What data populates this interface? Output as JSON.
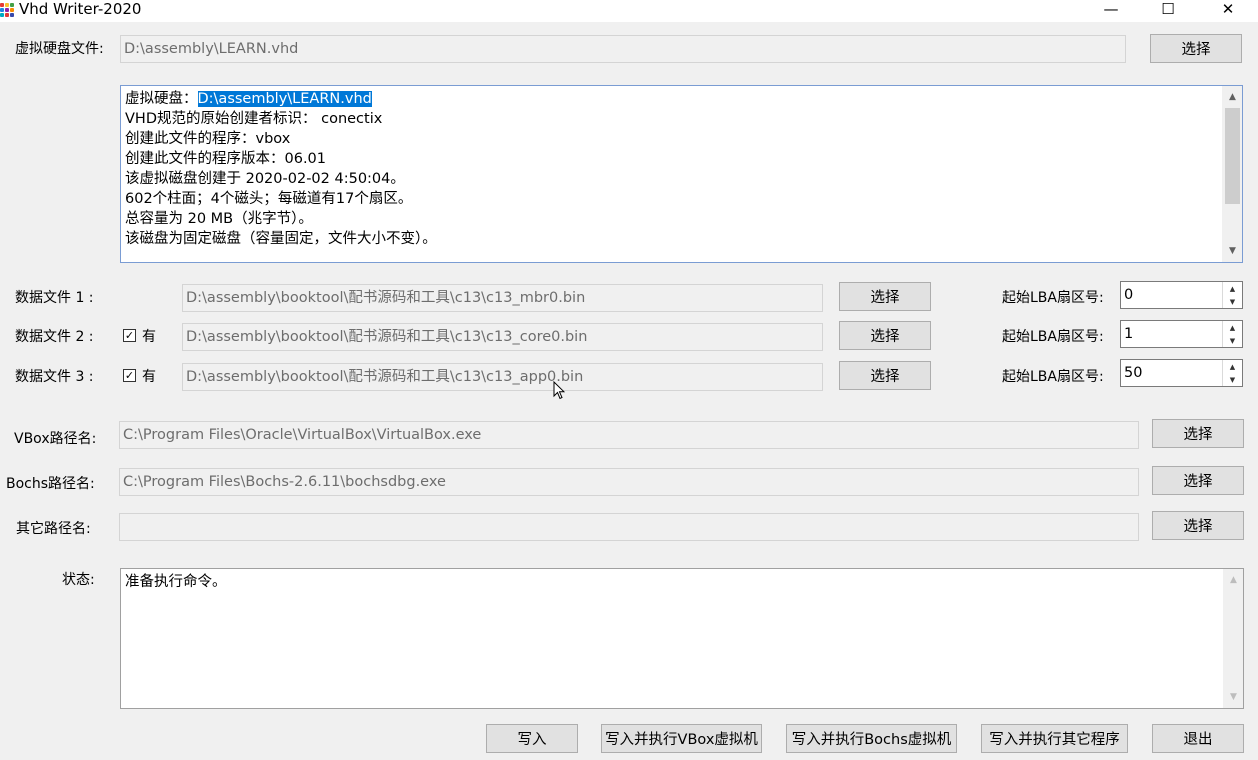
{
  "window": {
    "title": "Vhd Writer-2020",
    "minimize": "—",
    "maximize": "☐",
    "close": "✕"
  },
  "vhd": {
    "label": "虚拟硬盘文件:",
    "path": "D:\\assembly\\LEARN.vhd",
    "button": "选择"
  },
  "info": {
    "disk_label": "虚拟硬盘：",
    "disk_path": "D:\\assembly\\LEARN.vhd",
    "lines": [
      "VHD规范的原始创建者标识： conectix",
      "创建此文件的程序：vbox",
      "创建此文件的程序版本：06.01",
      "该虚拟磁盘创建于 2020-02-02 4:50:04。",
      "602个柱面；4个磁头；每磁道有17个扇区。",
      "总容量为 20 MB（兆字节）。",
      "该磁盘为固定磁盘（容量固定，文件大小不变）。"
    ]
  },
  "data_files": [
    {
      "label": "数据文件 1 :",
      "checkbox": null,
      "path": "D:\\assembly\\booktool\\配书源码和工具\\c13\\c13_mbr0.bin",
      "button": "选择",
      "lba_label": "起始LBA扇区号:",
      "lba": "0"
    },
    {
      "label": "数据文件 2 :",
      "checkbox": "有",
      "path": "D:\\assembly\\booktool\\配书源码和工具\\c13\\c13_core0.bin",
      "button": "选择",
      "lba_label": "起始LBA扇区号:",
      "lba": "1"
    },
    {
      "label": "数据文件 3 :",
      "checkbox": "有",
      "path": "D:\\assembly\\booktool\\配书源码和工具\\c13\\c13_app0.bin",
      "button": "选择",
      "lba_label": "起始LBA扇区号:",
      "lba": "50"
    }
  ],
  "vbox": {
    "label": "VBox路径名:",
    "path": "C:\\Program Files\\Oracle\\VirtualBox\\VirtualBox.exe",
    "button": "选择"
  },
  "bochs": {
    "label": "Bochs路径名:",
    "path": "C:\\Program Files\\Bochs-2.6.11\\bochsdbg.exe",
    "button": "选择"
  },
  "other": {
    "label": "其它路径名:",
    "path": "",
    "button": "选择"
  },
  "status": {
    "label": "状态:",
    "text": "准备执行命令。"
  },
  "footer": {
    "write": "写入",
    "write_vbox": "写入并执行VBox虚拟机",
    "write_bochs": "写入并执行Bochs虚拟机",
    "write_other": "写入并执行其它程序",
    "exit": "退出"
  },
  "colors": {
    "selection": "#0078d7",
    "window_bg": "#f0f0f0",
    "button_bg": "#e1e1e1"
  }
}
